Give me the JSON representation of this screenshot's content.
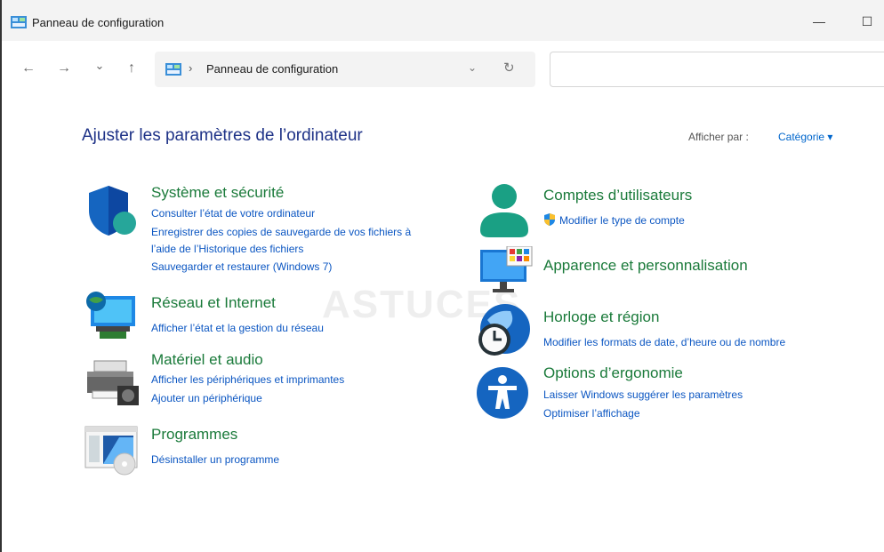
{
  "window": {
    "title": "Panneau de configuration",
    "minimize": "—",
    "maximize": "☐"
  },
  "nav": {
    "back": "←",
    "forward": "→",
    "recent": "⌄",
    "up": "↑"
  },
  "address": {
    "separator": "›",
    "path": "Panneau de configuration",
    "dropdown": "⌄",
    "refresh": "↻"
  },
  "search": {
    "placeholder": ""
  },
  "main": {
    "heading": "Ajuster les paramètres de l’ordinateur",
    "view_by_label": "Afficher par :",
    "view_by_value": "Catégorie ▾",
    "watermark": "ASTUCES"
  },
  "categories": {
    "system": {
      "title": "Système et sécurité",
      "links": [
        "Consulter l’état de votre ordinateur",
        "Enregistrer des copies de sauvegarde de vos fichiers à",
        "l’aide de l’Historique des fichiers",
        "Sauvegarder et restaurer (Windows 7)"
      ],
      "icon": "shield-icon"
    },
    "network": {
      "title": "Réseau et Internet",
      "links": [
        "Afficher l’état et la gestion du réseau"
      ],
      "icon": "network-globe-icon"
    },
    "hardware": {
      "title": "Matériel et audio",
      "links": [
        "Afficher les périphériques et imprimantes",
        "Ajouter un périphérique"
      ],
      "icon": "printer-icon"
    },
    "programs": {
      "title": "Programmes",
      "links": [
        "Désinstaller un programme"
      ],
      "icon": "programs-icon"
    },
    "accounts": {
      "title": "Comptes d’utilisateurs",
      "links": [
        "Modifier le type de compte"
      ],
      "icon": "user-icon"
    },
    "appearance": {
      "title": "Apparence et personnalisation",
      "links": [],
      "icon": "monitor-palette-icon"
    },
    "clock": {
      "title": "Horloge et région",
      "links": [
        "Modifier les formats de date, d’heure ou de nombre"
      ],
      "icon": "clock-globe-icon"
    },
    "ease": {
      "title": "Options d’ergonomie",
      "links": [
        "Laisser Windows suggérer les paramètres",
        "Optimiser l’affichage"
      ],
      "icon": "accessibility-icon"
    }
  },
  "colors": {
    "category_title": "#1a7a3a",
    "link": "#0b56c2",
    "heading": "#1e3287"
  }
}
